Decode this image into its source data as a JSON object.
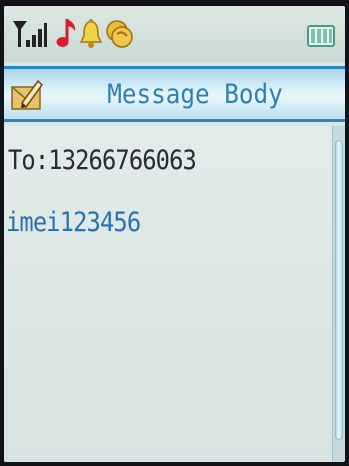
{
  "status_bar": {
    "icons": [
      "signal-strength-icon",
      "music-note-icon",
      "alarm-bell-icon",
      "vibrate-icon",
      "battery-icon"
    ]
  },
  "header": {
    "icon": "envelope-edit-icon",
    "title": "Message Body"
  },
  "message": {
    "recipient": "To:13266766063",
    "body": "imei123456"
  },
  "colors": {
    "title_text": "#2e7fb8",
    "title_border": "#2b87c2",
    "body_text": "#2f6fb0",
    "recipient_text": "#2a2a30",
    "background": "#d9e6e4"
  }
}
